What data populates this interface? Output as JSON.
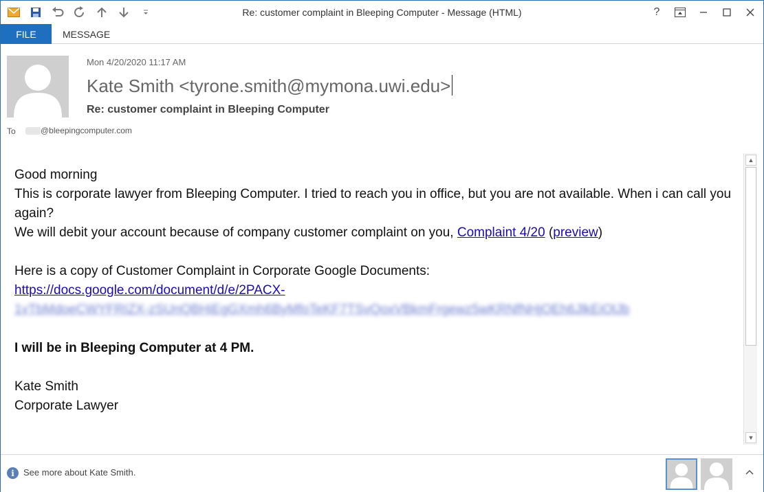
{
  "window": {
    "title": "Re: customer complaint in Bleeping Computer - Message (HTML)",
    "help": "?"
  },
  "ribbon": {
    "tabs": [
      "FILE",
      "MESSAGE"
    ]
  },
  "header": {
    "date": "Mon 4/20/2020 11:17 AM",
    "sender": "Kate Smith <tyrone.smith@mymona.uwi.edu>",
    "subject": "Re: customer complaint in Bleeping Computer",
    "to_label": "To",
    "to_address": "@bleepingcomputer.com"
  },
  "body": {
    "greeting": "Good morning",
    "line1": "This is corporate lawyer from Bleeping Computer. I tried to reach you in office, but you are not available. When i can call you again?",
    "line2_prefix": "We will debit your account because of company customer complaint on you, ",
    "link_complaint": "Complaint 4/20",
    "paren_open": " (",
    "link_preview": "preview",
    "paren_close": ")",
    "copy_line": "Here is a copy of Customer Complaint in Corporate Google Documents:",
    "doc_link": "https://docs.google.com/document/d/e/2PACX-",
    "doc_link_blurred": "1vTbMdoeCWYFRIZX-zSUnQBHiEgGXmh6ByMfoTeKF7TSvQoxVBkmFrgewz5wKRNfNHjOEh6JlkEiOlJb",
    "bold_line": "I will be in Bleeping Computer at 4 PM.",
    "sig_name": "Kate Smith",
    "sig_title": "Corporate Lawyer"
  },
  "people_pane": {
    "see_more": "See more about Kate Smith."
  },
  "colors": {
    "accent": "#1e6fc0",
    "link": "#1a0dab"
  }
}
